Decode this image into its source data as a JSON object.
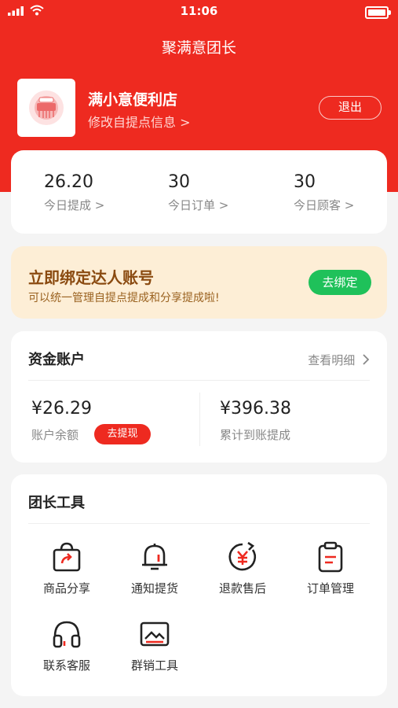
{
  "status_bar": {
    "time": "11:06"
  },
  "header": {
    "title": "聚满意团长"
  },
  "store": {
    "name": "满小意便利店",
    "edit_link": "修改自提点信息 >",
    "logout": "退出"
  },
  "stats": [
    {
      "value": "26.20",
      "label": "今日提成 >"
    },
    {
      "value": "30",
      "label": "今日订单 >"
    },
    {
      "value": "30",
      "label": "今日顾客 >"
    }
  ],
  "bind_banner": {
    "title": "立即绑定达人账号",
    "subtitle": "可以统一管理自提点提成和分享提成啦!",
    "button": "去绑定"
  },
  "funds": {
    "title": "资金账户",
    "detail_link": "查看明细",
    "balance": {
      "value": "¥26.29",
      "label": "账户余额",
      "button": "去提现"
    },
    "total": {
      "value": "¥396.38",
      "label": "累计到账提成"
    }
  },
  "tools": {
    "title": "团长工具",
    "items": [
      {
        "label": "商品分享",
        "icon": "share-bag-icon"
      },
      {
        "label": "通知提货",
        "icon": "bell-icon"
      },
      {
        "label": "退款售后",
        "icon": "refund-icon"
      },
      {
        "label": "订单管理",
        "icon": "clipboard-icon"
      },
      {
        "label": "联系客服",
        "icon": "headset-icon"
      },
      {
        "label": "群销工具",
        "icon": "image-icon"
      }
    ]
  },
  "colors": {
    "primary_red": "#ee2a20",
    "green": "#1fc15a",
    "banner_bg": "#fdeed6"
  }
}
